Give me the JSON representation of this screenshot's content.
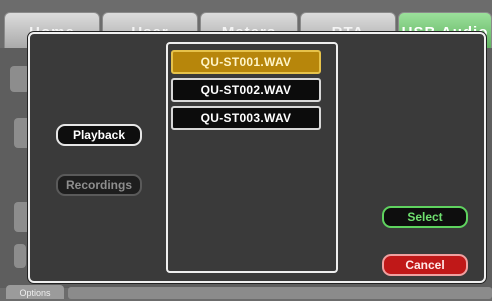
{
  "tabs": [
    {
      "label": "Home"
    },
    {
      "label": "User"
    },
    {
      "label": "Meters"
    },
    {
      "label": "RTA"
    },
    {
      "label": "USB Audio"
    }
  ],
  "bottom": {
    "options_label": "Options"
  },
  "modal": {
    "files": [
      {
        "name": "QU-ST001.WAV",
        "selected": true
      },
      {
        "name": "QU-ST002.WAV",
        "selected": false
      },
      {
        "name": "QU-ST003.WAV",
        "selected": false
      }
    ],
    "playback_label": "Playback",
    "recordings_label": "Recordings",
    "select_label": "Select",
    "cancel_label": "Cancel"
  },
  "colors": {
    "selected_file": "#b7860b",
    "select_accent": "#5fd35f",
    "cancel": "#c01818",
    "active_tab": "#7cc97c"
  }
}
